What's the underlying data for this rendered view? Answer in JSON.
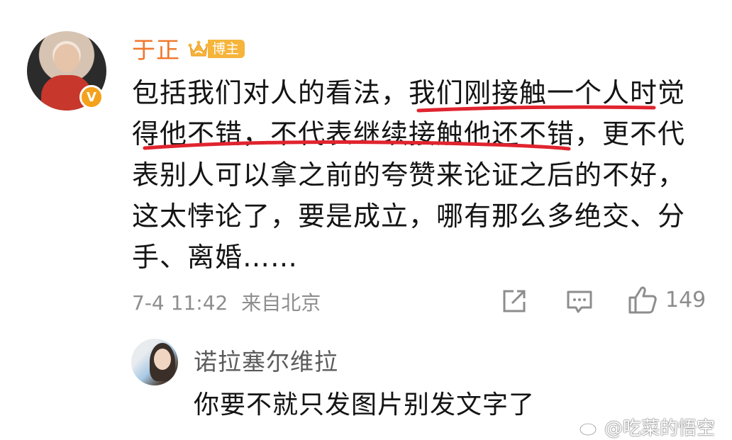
{
  "post": {
    "author": "于正",
    "badge_label": "博主",
    "verified_mark": "V",
    "content_lines": [
      "包括我们对人的看法，我们刚接触一个人时觉",
      "得他不错，不代表继续接触他还不错，更不代",
      "表别人可以拿之前的夸赞来论证之后的不好，",
      "这太悖论了，要是成立，哪有那么多绝交、分",
      "手、离婚……"
    ],
    "timestamp": "7-4 11:42",
    "location": "来自北京",
    "like_count": "149",
    "underline_color": "#e0242f",
    "author_color": "#f0772b"
  },
  "reply": {
    "author": "诺拉塞尔维拉",
    "text": "你要不就只发图片别发文字了"
  },
  "watermark": {
    "text": "@吃菜的悟空"
  },
  "icons": {
    "share": "share-icon",
    "comment": "comment-icon",
    "like": "thumbs-up-icon",
    "crown": "crown-icon",
    "weibo": "weibo-logo-icon"
  }
}
